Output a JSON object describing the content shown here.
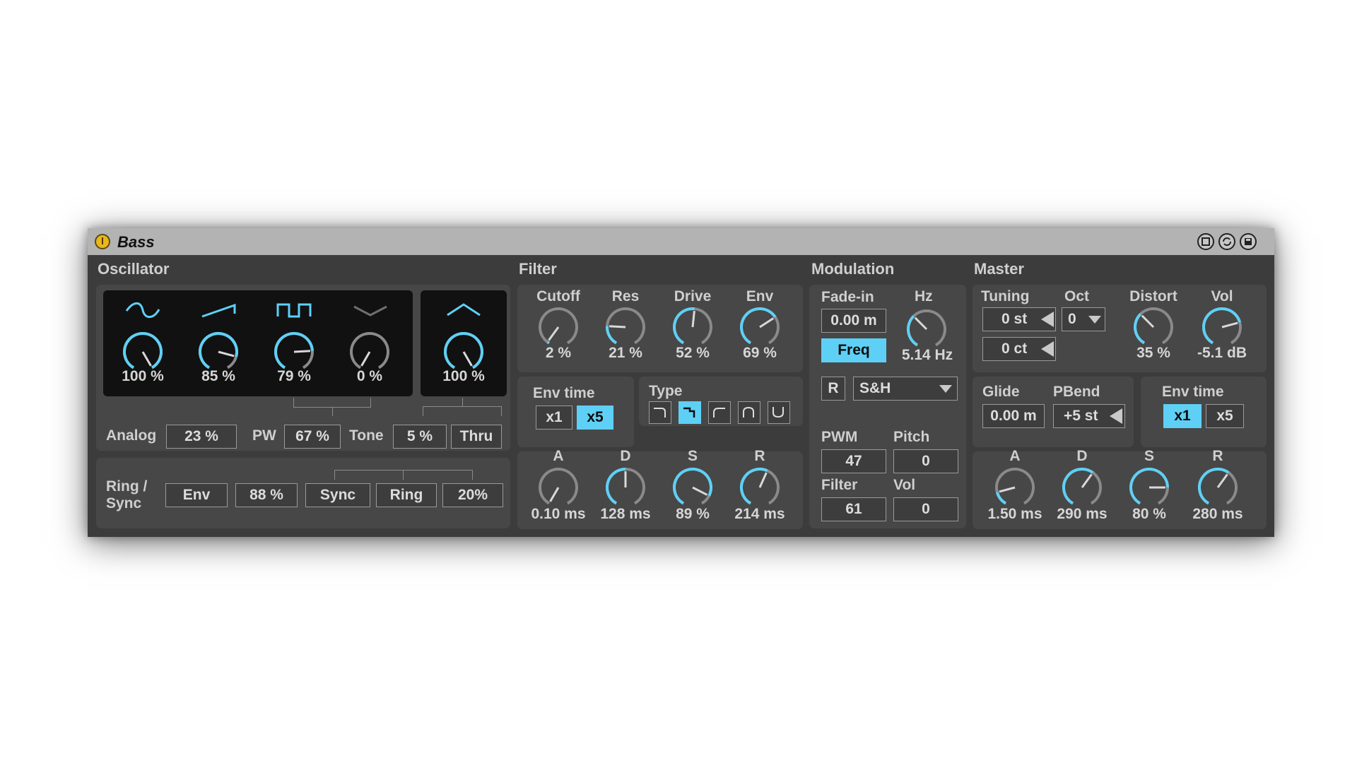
{
  "device": {
    "name": "Bass"
  },
  "sections": {
    "oscillator": "Oscillator",
    "filter": "Filter",
    "modulation": "Modulation",
    "master": "Master"
  },
  "oscillator": {
    "knobs": [
      {
        "wave": "sine-wave-icon",
        "value": "100 %",
        "level": 1.0
      },
      {
        "wave": "saw-wave-icon",
        "value": "85 %",
        "level": 0.85
      },
      {
        "wave": "square-wave-icon",
        "value": "79 %",
        "level": 0.79
      },
      {
        "wave": "noise-wave-icon",
        "value": "0 %",
        "level": 0.0
      },
      {
        "wave": "sub-wave-icon",
        "value": "100 %",
        "level": 1.0
      }
    ],
    "analog_label": "Analog",
    "analog_value": "23 %",
    "pw_label": "PW",
    "pw_value": "67 %",
    "tone_label": "Tone",
    "tone_value": "5 %",
    "thru_label": "Thru",
    "ring_sync_label_1": "Ring /",
    "ring_sync_label_2": "Sync",
    "env_label": "Env",
    "env_value": "88 %",
    "sync_label": "Sync",
    "ring_label": "Ring",
    "ring_value": "20%"
  },
  "filter": {
    "knobs": [
      {
        "label": "Cutoff",
        "value": "2 %",
        "level": 0.02
      },
      {
        "label": "Res",
        "value": "21 %",
        "level": 0.21
      },
      {
        "label": "Drive",
        "value": "52 %",
        "level": 0.52
      },
      {
        "label": "Env",
        "value": "69 %",
        "level": 0.69
      }
    ],
    "env_time_label": "Env time",
    "env_time_options": [
      "x1",
      "x5"
    ],
    "env_time_selected": "x5",
    "type_label": "Type",
    "type_selected": 1,
    "adsr": [
      {
        "label": "A",
        "value": "0.10 ms",
        "level": 0.0
      },
      {
        "label": "D",
        "value": "128 ms",
        "level": 0.5
      },
      {
        "label": "S",
        "value": "89 %",
        "level": 0.89
      },
      {
        "label": "R",
        "value": "214 ms",
        "level": 0.58
      }
    ]
  },
  "modulation": {
    "fadein_label": "Fade-in",
    "fadein_value": "0.00 m",
    "hz_label": "Hz",
    "hz_value": "5.14 Hz",
    "hz_level": 0.35,
    "freq_label": "Freq",
    "r_label": "R",
    "wave_select": "S&H",
    "pwm_label": "PWM",
    "pwm_value": "47",
    "pitch_label": "Pitch",
    "pitch_value": "0",
    "filter_label": "Filter",
    "filter_value": "61",
    "vol_label": "Vol",
    "vol_value": "0"
  },
  "master": {
    "tuning_label": "Tuning",
    "tuning_st": "0 st",
    "tuning_ct": "0 ct",
    "oct_label": "Oct",
    "oct_value": "0",
    "distort_label": "Distort",
    "distort_value": "35 %",
    "distort_level": 0.35,
    "vol_label": "Vol",
    "vol_value": "-5.1 dB",
    "vol_level": 0.75,
    "glide_label": "Glide",
    "glide_value": "0.00 m",
    "pbend_label": "PBend",
    "pbend_value": "+5 st",
    "env_time_label": "Env time",
    "env_time_options": [
      "x1",
      "x5"
    ],
    "env_time_selected": "x1",
    "adsr": [
      {
        "label": "A",
        "value": "1.50 ms",
        "level": 0.15
      },
      {
        "label": "D",
        "value": "290 ms",
        "level": 0.62
      },
      {
        "label": "S",
        "value": "80 %",
        "level": 0.8
      },
      {
        "label": "R",
        "value": "280 ms",
        "level": 0.62
      }
    ]
  },
  "colors": {
    "accent": "#5fd0f5",
    "panel": "#474747",
    "background": "#3c3c3c",
    "knob_track": "#8a8a8a",
    "power": "#e9b71d"
  }
}
